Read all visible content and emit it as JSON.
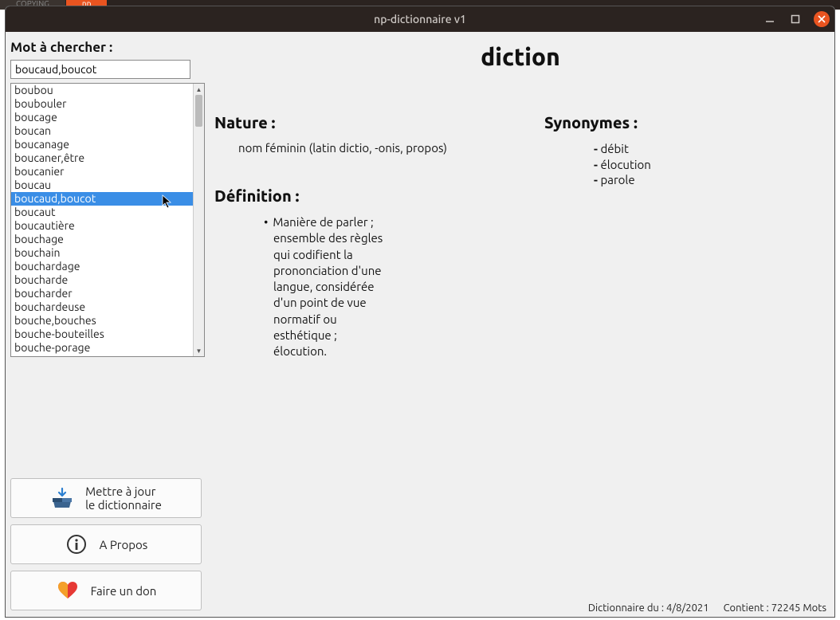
{
  "bg_tabs": {
    "left": "COPYING",
    "active": "np"
  },
  "window": {
    "title": "np-dictionnaire v1"
  },
  "search": {
    "label": "Mot à chercher :",
    "value": "boucaud,boucot",
    "dropdown_items": [
      "boubou",
      "boubouler",
      "boucage",
      "boucan",
      "boucanage",
      "boucaner,être",
      "boucanier",
      "boucau",
      "boucaud,boucot",
      "boucaut",
      "boucautière",
      "bouchage",
      "bouchain",
      "bouchardage",
      "boucharde",
      "boucharder",
      "bouchardeuse",
      "bouche,bouches",
      "bouche-bouteilles",
      "bouche-porage"
    ],
    "selected_index": 8
  },
  "entry": {
    "word": "diction",
    "nature_label": "Nature :",
    "nature_value": "nom féminin (latin dictio, -onis, propos)",
    "definition_label": "Définition :",
    "definitions": [
      "Manière de parler ; ensemble des règles qui codifient la prononciation d'une langue, considérée d'un point de vue normatif ou esthétique ; élocution."
    ],
    "synonyms_label": "Synonymes :",
    "synonyms": [
      "débit",
      "élocution",
      "parole"
    ]
  },
  "buttons": {
    "update_line1": "Mettre à jour",
    "update_line2": "le dictionnaire",
    "about": "A Propos",
    "donate": "Faire un don"
  },
  "status": {
    "date_label": "Dictionnaire du :",
    "date_value": "4/8/2021",
    "count_label": "Contient :",
    "count_value": "72245 Mots"
  },
  "colors": {
    "accent": "#e95420",
    "select": "#3a8ee6"
  }
}
